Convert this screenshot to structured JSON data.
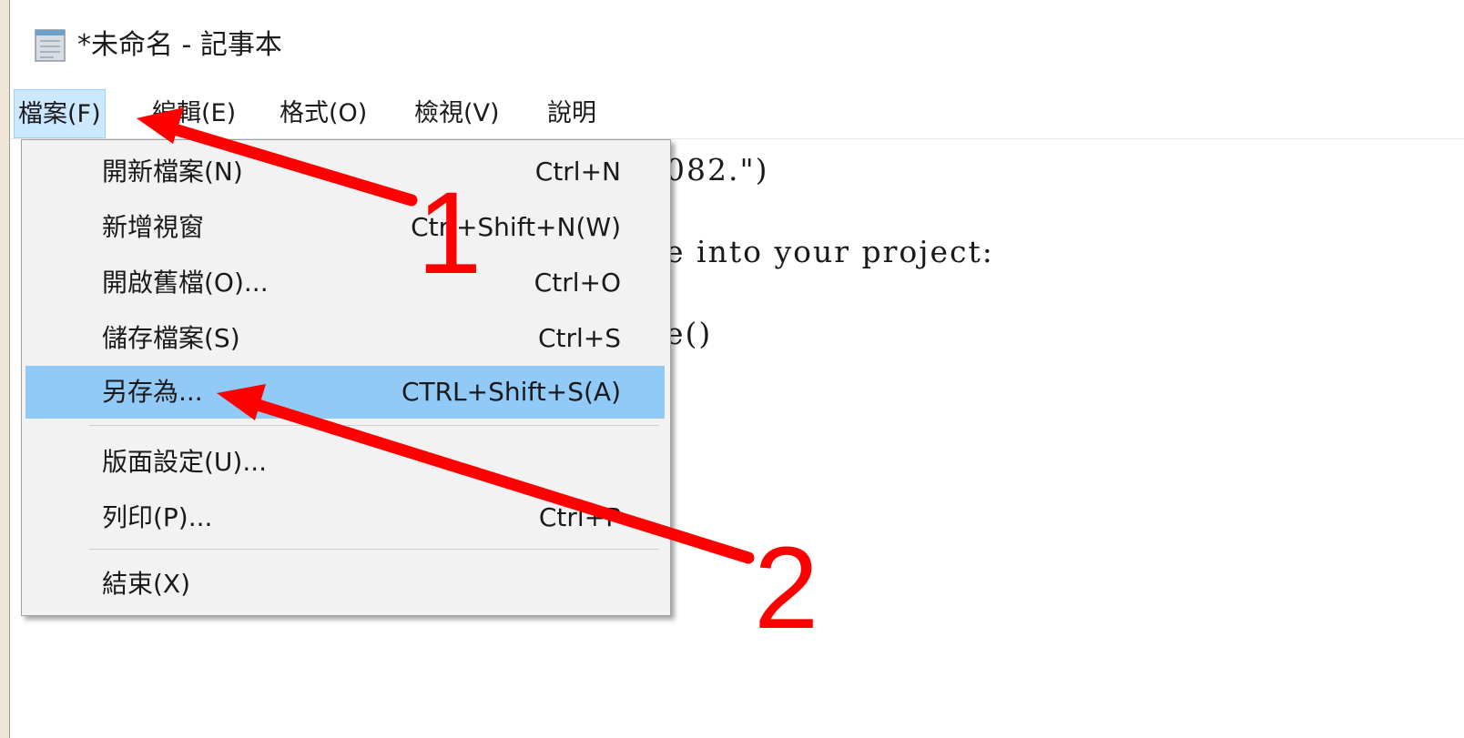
{
  "window": {
    "title": "*未命名 - 記事本",
    "icon": "notepad-icon"
  },
  "menubar": {
    "items": [
      {
        "label": "檔案(F)"
      },
      {
        "label": "編輯(E)"
      },
      {
        "label": "格式(O)"
      },
      {
        "label": "檢視(V)"
      },
      {
        "label": "說明"
      }
    ]
  },
  "editor": {
    "lines": [
      "082.\")",
      "e into your project:",
      "e()"
    ]
  },
  "file_menu": {
    "items": [
      {
        "label": "開新檔案(N)",
        "shortcut": "Ctrl+N"
      },
      {
        "label": "新增視窗",
        "shortcut": "Ctrl+Shift+N(W)"
      },
      {
        "label": "開啟舊檔(O)...",
        "shortcut": "Ctrl+O"
      },
      {
        "label": "儲存檔案(S)",
        "shortcut": "Ctrl+S"
      },
      {
        "label": "另存為...",
        "shortcut": "CTRL+Shift+S(A)"
      },
      {
        "label": "版面設定(U)...",
        "shortcut": ""
      },
      {
        "label": "列印(P)...",
        "shortcut": "Ctrl+P"
      },
      {
        "label": "結束(X)",
        "shortcut": ""
      }
    ],
    "highlight_color": "#91c9f7"
  },
  "annotations": {
    "step1": "1",
    "step2": "2",
    "arrow_color": "#ff0000"
  }
}
